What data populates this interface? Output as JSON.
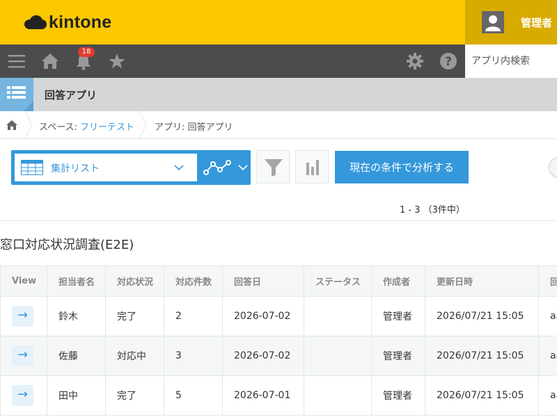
{
  "header": {
    "logo_text": "kintone",
    "user_name": "管理者",
    "brand_color": "#fcc800"
  },
  "nav": {
    "notification_count": "18",
    "search_placeholder": "アプリ内検索",
    "icons": [
      "menu-icon",
      "home-icon",
      "bell-icon",
      "star-icon",
      "gear-icon",
      "help-icon"
    ]
  },
  "app": {
    "title": "回答アプリ"
  },
  "breadcrumb": {
    "space_prefix": "スペース: ",
    "space_name": "フリーテスト",
    "app_label": "アプリ: 回答アプリ"
  },
  "toolbar": {
    "view_name": "集計リスト",
    "analyze_label": "現在の条件で分析する",
    "pager": "1 - 3 （3件中）"
  },
  "content": {
    "form_title": "窓口対応状況調査(E2E)",
    "columns": [
      "View",
      "担当者名",
      "対応状況",
      "対応件数",
      "回答日",
      "ステータス",
      "作成者",
      "更新日時",
      "回"
    ],
    "rows": [
      {
        "link": "→",
        "person": "鈴木",
        "status": "完了",
        "count": "2",
        "date": "2026-07-02",
        "state": "",
        "creator": "管理者",
        "updated": "2026/07/21 15:05",
        "extra": "aa"
      },
      {
        "link": "→",
        "person": "佐藤",
        "status": "対応中",
        "count": "3",
        "date": "2026-07-02",
        "state": "",
        "creator": "管理者",
        "updated": "2026/07/21 15:05",
        "extra": "aa"
      },
      {
        "link": "→",
        "person": "田中",
        "status": "完了",
        "count": "5",
        "date": "2026-07-01",
        "state": "",
        "creator": "管理者",
        "updated": "2026/07/21 15:05",
        "extra": "aa"
      }
    ]
  }
}
